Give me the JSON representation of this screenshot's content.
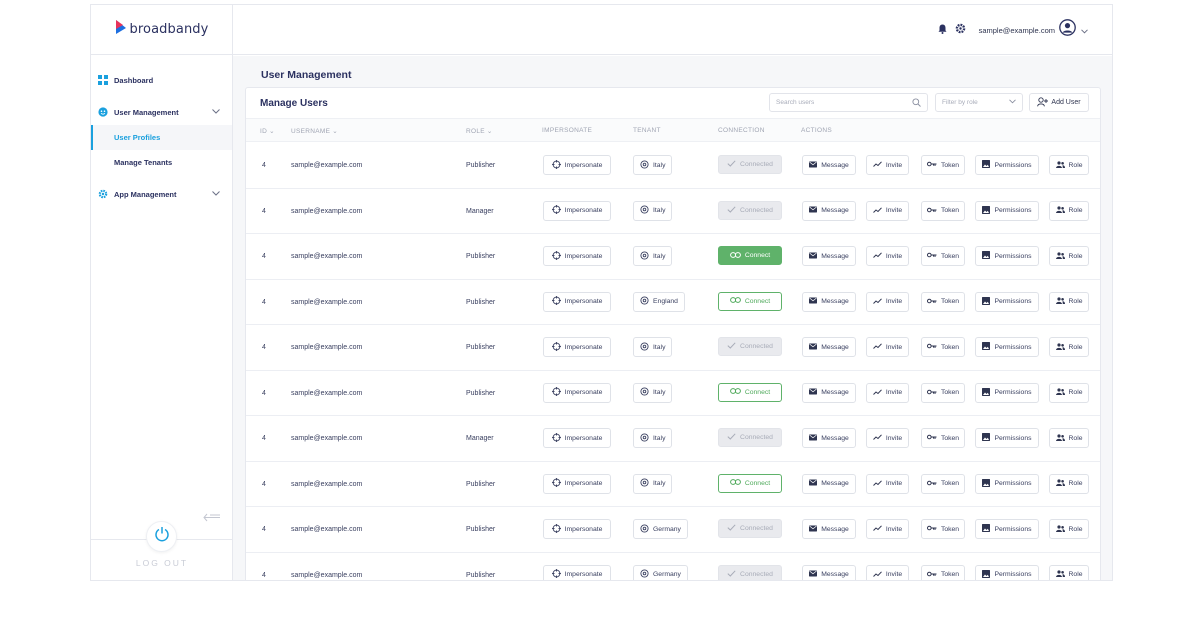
{
  "app": {
    "brand": "broadbandy",
    "user_email": "sample@example.com",
    "colors": {
      "accent": "#1aa0de",
      "brand_blue": "#2b3160",
      "connect_green": "#5fb26a",
      "logo_red": "#e8335b",
      "logo_blue": "#1d6fe0"
    }
  },
  "sidebar": {
    "items": [
      {
        "label": "Dashboard",
        "icon": "grid-icon"
      },
      {
        "label": "User Management",
        "icon": "user-circle-icon"
      },
      {
        "label": "App Management",
        "icon": "gear-icon"
      }
    ],
    "sub_items": [
      {
        "label": "User Profiles",
        "active": true
      },
      {
        "label": "Manage Tenants",
        "active": false
      }
    ],
    "logout": "LOG OUT"
  },
  "page": {
    "title": "User Management"
  },
  "card": {
    "title": "Manage Users",
    "search_placeholder": "Search users",
    "filter_placeholder": "Filter by role",
    "add_user": "Add User"
  },
  "table": {
    "headers": {
      "id": "ID",
      "username": "USERNAME",
      "role": "ROLE",
      "impersonate": "IMPERSONATE",
      "tenant": "TENANT",
      "connection": "CONNECTION",
      "actions": "ACTIONS"
    },
    "action_labels": {
      "impersonate": "Impersonate",
      "message": "Message",
      "invite": "Invite",
      "token": "Token",
      "permissions": "Permissions",
      "role": "Role"
    },
    "connection_labels": {
      "connected": "Connected",
      "connect": "Connect"
    },
    "rows": [
      {
        "id": "4",
        "username": "sample@example.com",
        "role": "Publisher",
        "tenant": "Italy",
        "connection": "connected"
      },
      {
        "id": "4",
        "username": "sample@example.com",
        "role": "Manager",
        "tenant": "Italy",
        "connection": "connected"
      },
      {
        "id": "4",
        "username": "sample@example.com",
        "role": "Publisher",
        "tenant": "Italy",
        "connection": "connect-filled"
      },
      {
        "id": "4",
        "username": "sample@example.com",
        "role": "Publisher",
        "tenant": "England",
        "connection": "connect-outline"
      },
      {
        "id": "4",
        "username": "sample@example.com",
        "role": "Publisher",
        "tenant": "Italy",
        "connection": "connected"
      },
      {
        "id": "4",
        "username": "sample@example.com",
        "role": "Publisher",
        "tenant": "Italy",
        "connection": "connect-outline"
      },
      {
        "id": "4",
        "username": "sample@example.com",
        "role": "Manager",
        "tenant": "Italy",
        "connection": "connected"
      },
      {
        "id": "4",
        "username": "sample@example.com",
        "role": "Publisher",
        "tenant": "Italy",
        "connection": "connect-outline"
      },
      {
        "id": "4",
        "username": "sample@example.com",
        "role": "Publisher",
        "tenant": "Germany",
        "connection": "connected"
      },
      {
        "id": "4",
        "username": "sample@example.com",
        "role": "Publisher",
        "tenant": "Germany",
        "connection": "connected"
      }
    ]
  }
}
